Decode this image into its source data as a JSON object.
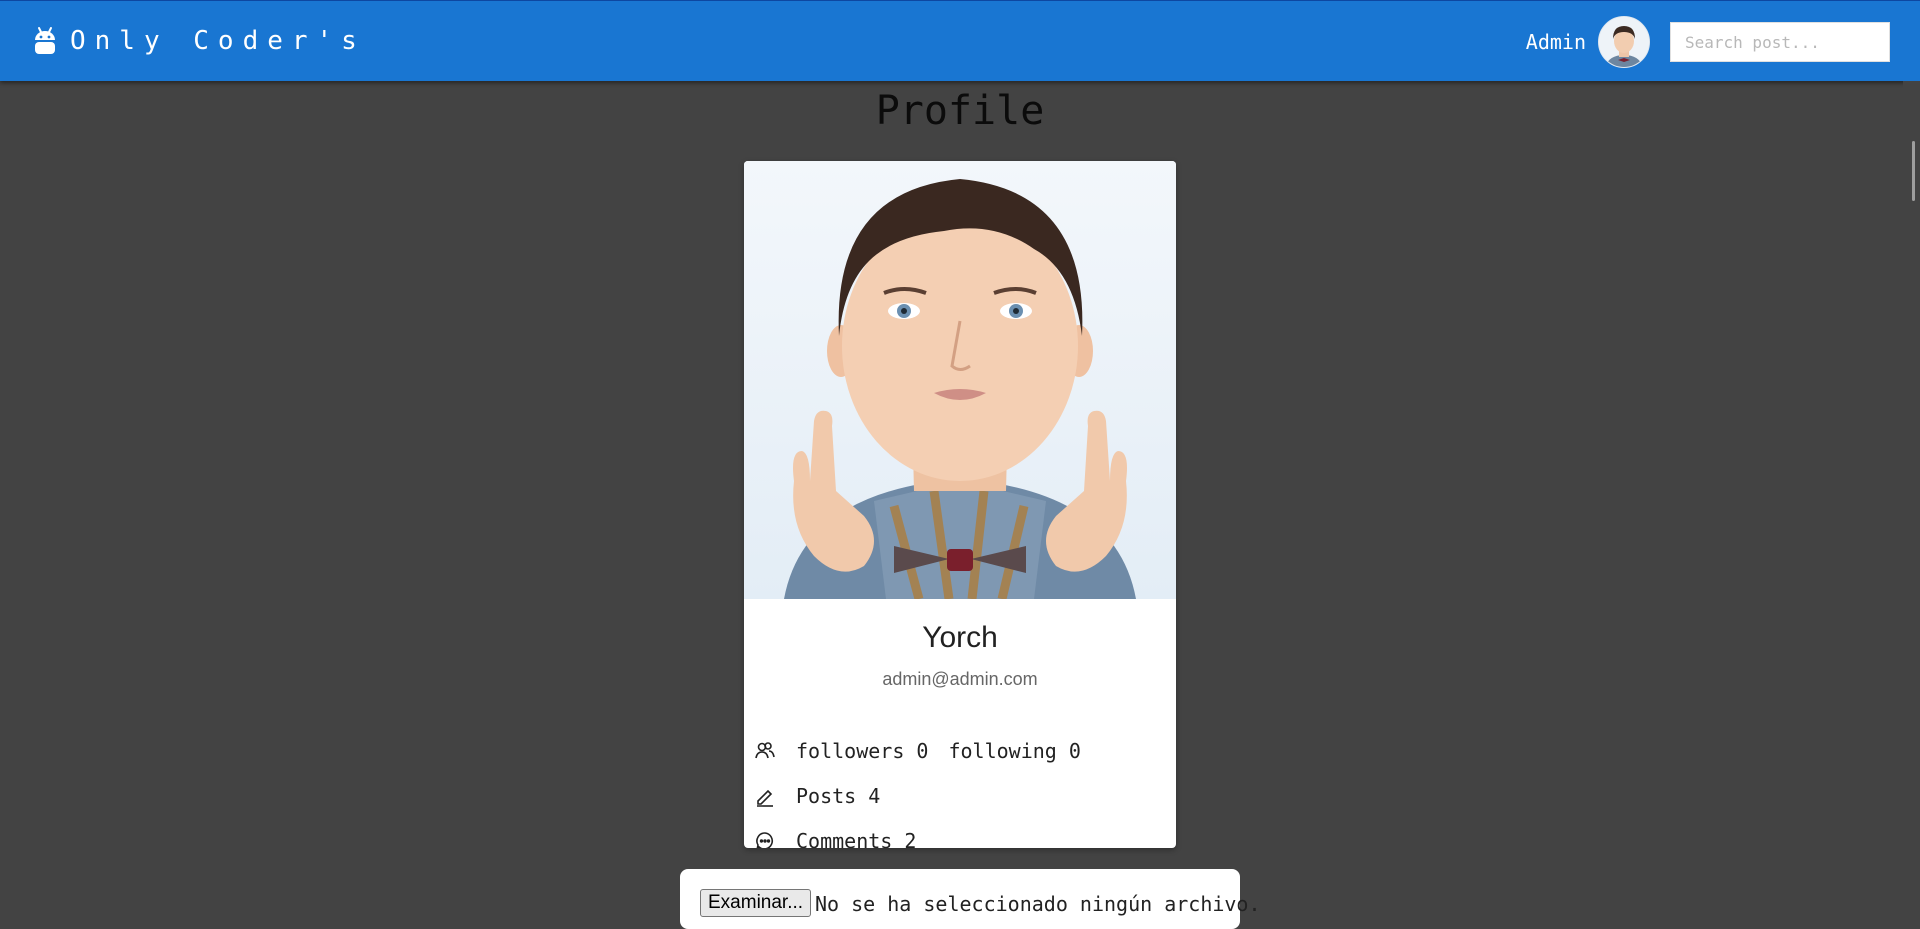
{
  "navbar": {
    "brand_icon": "android-icon",
    "brand_text": "Only Coder's",
    "username": "Admin",
    "search_placeholder": "Search post...",
    "background_color": "#1976d2"
  },
  "page": {
    "title": "Profile",
    "background_color": "#434343"
  },
  "profile": {
    "name": "Yorch",
    "email": "admin@admin.com",
    "stats": {
      "followers_label": "followers",
      "followers_count": "0",
      "following_label": "following",
      "following_count": "0",
      "posts_label": "Posts",
      "posts_count": "4",
      "comments_label": "Comments",
      "comments_count": "2"
    }
  },
  "upload": {
    "button_label": "Examinar...",
    "status_text": "No se ha seleccionado ningún archivo."
  }
}
